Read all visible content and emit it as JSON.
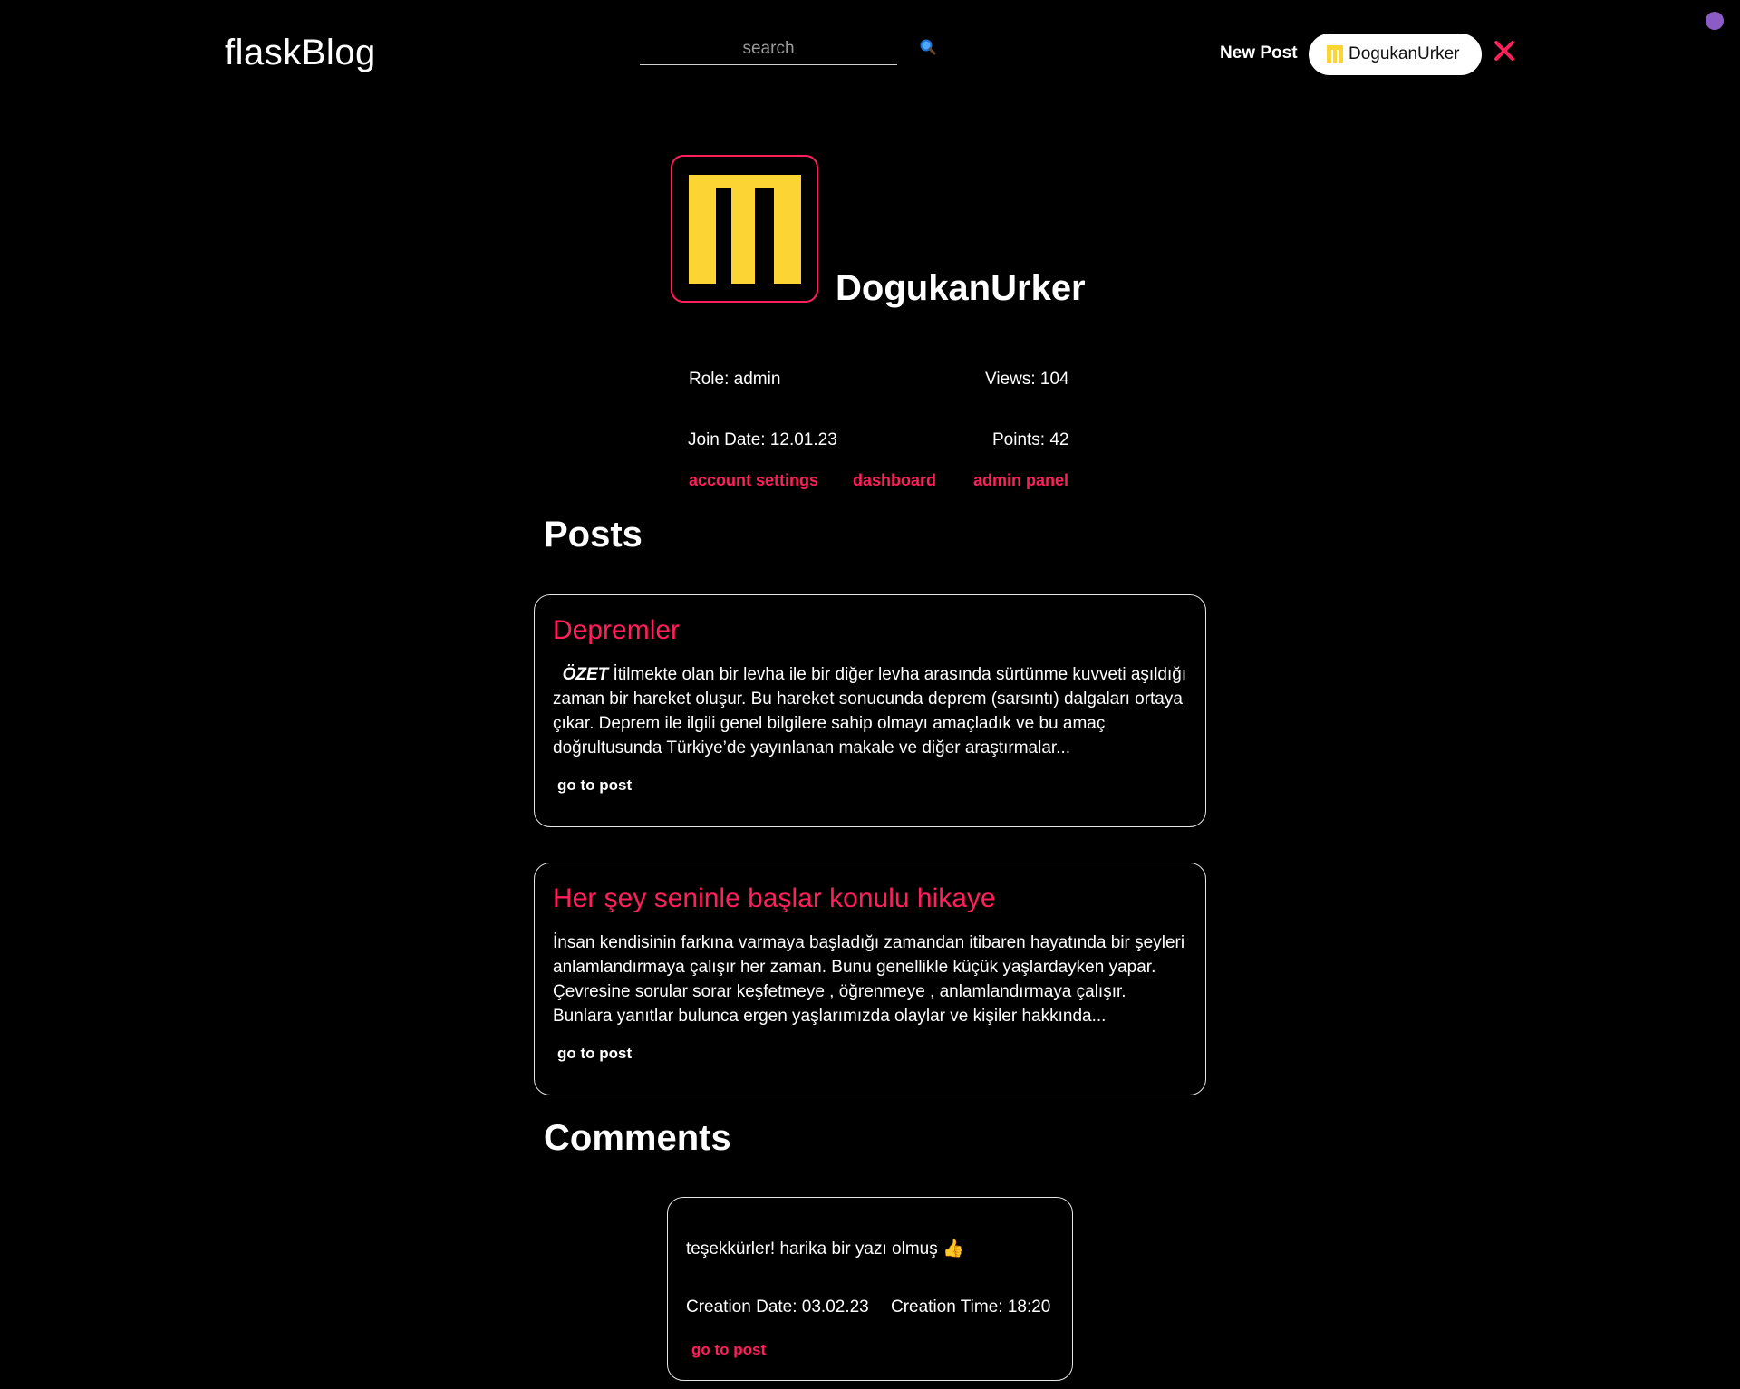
{
  "nav": {
    "logo": "flaskBlog",
    "search_placeholder": "search",
    "new_post": "New Post",
    "user": "DogukanUrker"
  },
  "profile": {
    "username": "DogukanUrker",
    "role": "Role: admin",
    "views": "Views: 104",
    "join_date": "Join Date: 12.01.23",
    "points": "Points: 42",
    "links": {
      "account_settings": "account settings",
      "dashboard": "dashboard",
      "admin_panel": "admin panel"
    }
  },
  "posts_heading": "Posts",
  "posts": [
    {
      "title": "Depremler",
      "body_lead": "ÖZET",
      "body": " İtilmekte olan bir levha ile bir diğer levha arasında sürtünme kuvveti aşıldığı zaman bir hareket oluşur. Bu hareket sonucunda deprem (sarsıntı) dalgaları ortaya çıkar. Deprem ile ilgili genel bilgilere sahip olmayı amaçladık ve bu amaç doğrultusunda Türkiye’de yayınlanan makale ve diğer araştırmalar...",
      "link": "go to post"
    },
    {
      "title": "Her şey seninle başlar konulu hikaye",
      "body_lead": "",
      "body": "İnsan kendisinin farkına varmaya başladığı zamandan itibaren hayatında bir şeyleri anlamlandırmaya çalışır her zaman. Bunu genellikle küçük yaşlardayken yapar. Çevresine sorular sorar keşfetmeye , öğrenmeye , anlamlandırmaya çalışır. Bunlara yanıtlar bulunca ergen yaşlarımızda olaylar ve kişiler hakkında...",
      "link": "go to post"
    }
  ],
  "comments_heading": "Comments",
  "comments": [
    {
      "text": "teşekkürler! harika bir yazı olmuş 👍",
      "creation_date": "Creation Date: 03.02.23",
      "creation_time": "Creation Time: 18:20",
      "link": "go to post"
    }
  ],
  "colors": {
    "accent": "#ff1f5a",
    "avatar_yellow": "#fcd535",
    "background": "#000000"
  },
  "icons": [
    "search-icon",
    "close-icon",
    "avatar-logo-icon",
    "thumbs-up-icon"
  ]
}
